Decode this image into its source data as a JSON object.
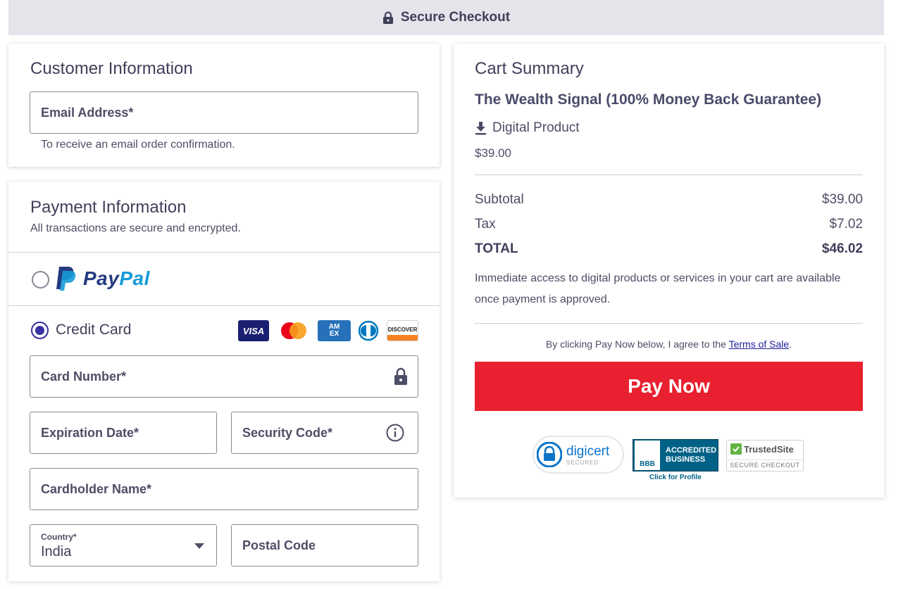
{
  "header": {
    "title": "Secure Checkout",
    "icon": "lock-icon"
  },
  "customer": {
    "title": "Customer Information",
    "email_label": "Email Address*",
    "email_hint": "To receive an email order confirmation."
  },
  "payment": {
    "title": "Payment Information",
    "subtitle": "All transactions are secure and encrypted.",
    "paypal": {
      "pay": "Pay",
      "pal": "Pal",
      "selected": false
    },
    "credit_card": {
      "label": "Credit Card",
      "selected": true,
      "logos": [
        "visa",
        "mastercard",
        "amex",
        "diners",
        "discover"
      ],
      "visa_text": "VISA",
      "amex_text": "AM EX",
      "discover_text": "DISCOVER"
    },
    "card_number": "Card Number*",
    "expiration": "Expiration Date*",
    "security_code": "Security Code*",
    "cardholder": "Cardholder Name*",
    "country_label": "Country*",
    "country_value": "India",
    "postal_code": "Postal Code"
  },
  "cart": {
    "title": "Cart Summary",
    "product_name": "The Wealth Signal (100% Money Back Guarantee)",
    "product_type": "Digital Product",
    "product_price": "$39.00",
    "subtotal_label": "Subtotal",
    "subtotal": "$39.00",
    "tax_label": "Tax",
    "tax": "$7.02",
    "total_label": "TOTAL",
    "total": "$46.02",
    "access_note": "Immediate access to digital products or services in your cart are available once payment is approved.",
    "agree_prefix": "By clicking Pay Now below, I agree to the ",
    "terms_link": "Terms of Sale",
    "agree_suffix": ".",
    "pay_button": "Pay Now"
  },
  "badges": {
    "digicert": "digicert",
    "digicert_sub": "SECURED",
    "bbb_line1": "ACCREDITED",
    "bbb_line2": "BUSINESS",
    "bbb_logo": "BBB",
    "bbb_click": "Click for Profile",
    "trusted": "TrustedSite",
    "trusted_sub": "SECURE CHECKOUT"
  },
  "colors": {
    "accent": "#3730a3",
    "pay_button": "#e8202f",
    "text": "#3f3f5a",
    "paypal_dark": "#253b80",
    "paypal_light": "#179bd7"
  }
}
